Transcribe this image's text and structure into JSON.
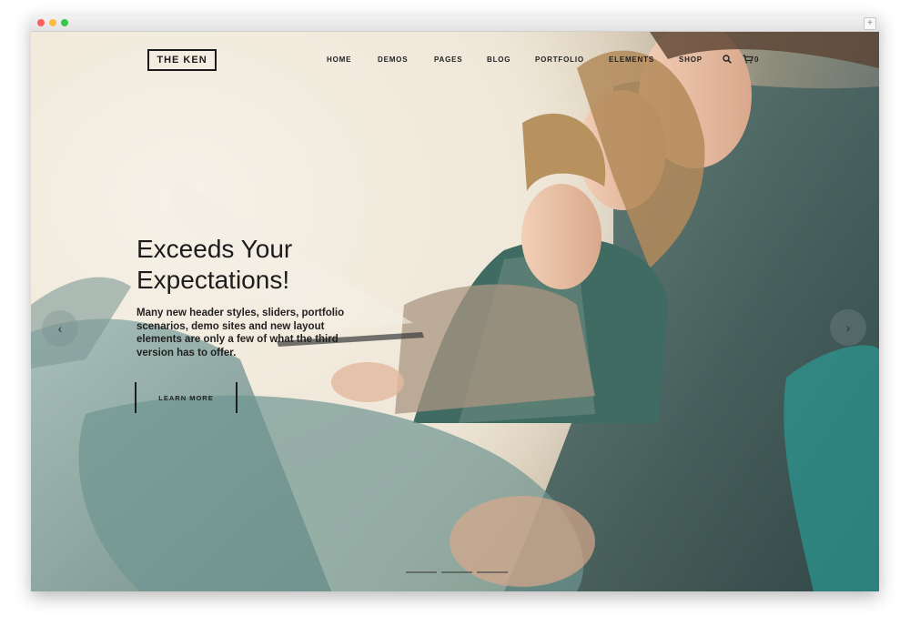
{
  "brand": {
    "logo_text": "THE KEN"
  },
  "nav": {
    "items": [
      {
        "label": "HOME"
      },
      {
        "label": "DEMOS"
      },
      {
        "label": "PAGES"
      },
      {
        "label": "BLOG"
      },
      {
        "label": "PORTFOLIO"
      },
      {
        "label": "ELEMENTS"
      },
      {
        "label": "SHOP"
      }
    ],
    "cart_count": "0"
  },
  "hero": {
    "headline_line1": "Exceeds Your",
    "headline_line2": "Expectations!",
    "description": "Many new header styles, sliders, portfolio scenarios, demo sites and new layout elements are only a few of what the third version has to offer.",
    "cta_label": "LEARN MORE"
  },
  "slider": {
    "prev_symbol": "‹",
    "next_symbol": "›",
    "slide_count": 3
  },
  "icons": [
    "search-icon",
    "cart-icon",
    "chevron-left-icon",
    "chevron-right-icon"
  ],
  "colors": {
    "text": "#1c1c1c",
    "background": "#f3ede3",
    "accent_teal": "#4f7b78"
  }
}
